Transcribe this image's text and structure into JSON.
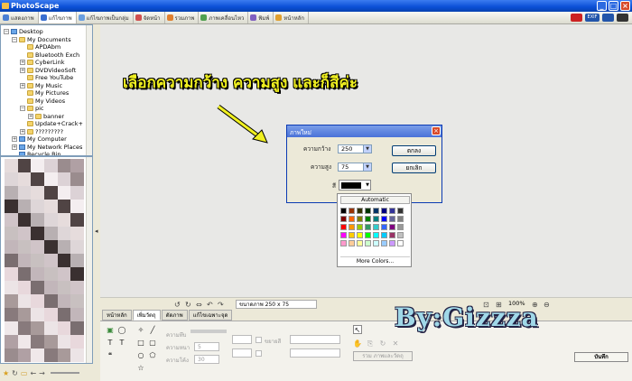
{
  "window": {
    "title": "PhotoScape"
  },
  "tabs": [
    {
      "label": "แสดงภาพ",
      "color": "#4a7fd4"
    },
    {
      "label": "แก้ไขภาพ",
      "color": "#3a6fd0"
    },
    {
      "label": "แก้ไขภาพเป็นกลุ่ม",
      "color": "#6a9fe0"
    },
    {
      "label": "จัดหน้า",
      "color": "#d05050"
    },
    {
      "label": "รวมภาพ",
      "color": "#e08030"
    },
    {
      "label": "ภาพเคลื่อนไหว",
      "color": "#50a050"
    },
    {
      "label": "พิมพ์",
      "color": "#8060c0"
    },
    {
      "label": "หน้าหลัก",
      "color": "#e0a030"
    }
  ],
  "tree": [
    {
      "label": "Desktop",
      "indent": 0,
      "type": "pc",
      "exp": "-"
    },
    {
      "label": "My Documents",
      "indent": 1,
      "type": "folder",
      "exp": "-"
    },
    {
      "label": "APDAbm",
      "indent": 2,
      "type": "folder",
      "exp": ""
    },
    {
      "label": "Bluetooth Exch",
      "indent": 2,
      "type": "folder",
      "exp": ""
    },
    {
      "label": "CyberLink",
      "indent": 2,
      "type": "folder",
      "exp": "+"
    },
    {
      "label": "DVDVideoSoft",
      "indent": 2,
      "type": "folder",
      "exp": "+"
    },
    {
      "label": "Free YouTube",
      "indent": 2,
      "type": "folder",
      "exp": ""
    },
    {
      "label": "My Music",
      "indent": 2,
      "type": "folder",
      "exp": "+"
    },
    {
      "label": "My Pictures",
      "indent": 2,
      "type": "folder",
      "exp": ""
    },
    {
      "label": "My Videos",
      "indent": 2,
      "type": "folder",
      "exp": ""
    },
    {
      "label": "pic",
      "indent": 2,
      "type": "folder",
      "exp": "-"
    },
    {
      "label": "banner",
      "indent": 3,
      "type": "folder",
      "exp": "+"
    },
    {
      "label": "Update+Crack+",
      "indent": 2,
      "type": "folder",
      "exp": ""
    },
    {
      "label": "?????????",
      "indent": 2,
      "type": "folder",
      "exp": "+"
    },
    {
      "label": "My Computer",
      "indent": 1,
      "type": "pc",
      "exp": "+"
    },
    {
      "label": "My Network Places",
      "indent": 1,
      "type": "pc",
      "exp": "+"
    },
    {
      "label": "Recycle Bin",
      "indent": 1,
      "type": "pc",
      "exp": ""
    }
  ],
  "annotation": {
    "text": "เลือกความกว้าง ความสูง และก็สีค่ะ"
  },
  "dialog": {
    "title": "ภาพใหม่",
    "width_label": "ความกว้าง",
    "width_value": "250",
    "height_label": "ความสูง",
    "height_value": "75",
    "color_label": "สี",
    "ok_label": "ตกลง",
    "cancel_label": "ยกเลิก"
  },
  "palette": {
    "automatic_label": "Automatic",
    "more_label": "More Colors...",
    "colors": [
      "#000000",
      "#993300",
      "#333300",
      "#003300",
      "#003366",
      "#000080",
      "#333399",
      "#333333",
      "#800000",
      "#ff6600",
      "#808000",
      "#008000",
      "#008080",
      "#0000ff",
      "#666699",
      "#808080",
      "#ff0000",
      "#ff9900",
      "#99cc00",
      "#339966",
      "#33cccc",
      "#3366ff",
      "#800080",
      "#999999",
      "#ff00ff",
      "#ffcc00",
      "#ffff00",
      "#00ff00",
      "#00ffff",
      "#00ccff",
      "#993366",
      "#c0c0c0",
      "#ff99cc",
      "#ffcc99",
      "#ffff99",
      "#ccffcc",
      "#ccffff",
      "#99ccff",
      "#cc99ff",
      "#ffffff"
    ]
  },
  "status": {
    "size_text": "ขนาดภาพ 250 x 75",
    "zoom": "100%"
  },
  "bottom_tabs": [
    "หน้าหลัก",
    "เพิ่มวัตถุ",
    "ตัดภาพ",
    "แก้ไขเฉพาะจุด"
  ],
  "panel": {
    "label1": "ความทึบ",
    "label2": "ความหนา",
    "label3": "ความโค้ง",
    "value2": "5",
    "value3": "30",
    "merge_label": "รวม ภาพและวัตถุ",
    "check_label": "ขยายสี"
  },
  "watermark": {
    "text": "By:Gizzza"
  },
  "right_buttons": {
    "save_label": "บันทึก"
  },
  "topicons": [
    {
      "label": "",
      "color": "#cc2222"
    },
    {
      "label": "EXIF",
      "color": "#2255aa"
    },
    {
      "label": "",
      "color": "#2255aa"
    },
    {
      "label": "",
      "color": "#333333"
    }
  ]
}
